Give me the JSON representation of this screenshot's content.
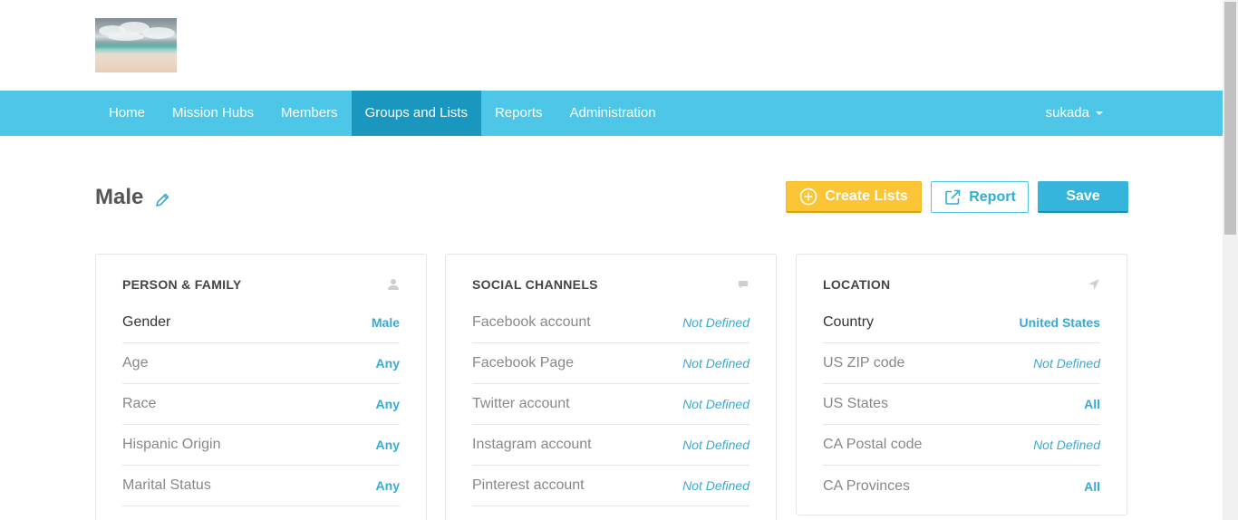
{
  "nav": {
    "items": [
      {
        "label": "Home",
        "active": false
      },
      {
        "label": "Mission Hubs",
        "active": false
      },
      {
        "label": "Members",
        "active": false
      },
      {
        "label": "Groups and Lists",
        "active": true
      },
      {
        "label": "Reports",
        "active": false
      },
      {
        "label": "Administration",
        "active": false
      }
    ],
    "user": "sukada"
  },
  "page": {
    "title": "Male"
  },
  "toolbar": {
    "create_label": "Create Lists",
    "report_label": "Report",
    "save_label": "Save"
  },
  "cards": {
    "person": {
      "title": "PERSON & FAMILY",
      "icon": "user-icon",
      "rows": [
        {
          "label": "Gender",
          "value": "Male"
        },
        {
          "label": "Age",
          "value": "Any"
        },
        {
          "label": "Race",
          "value": "Any"
        },
        {
          "label": "Hispanic Origin",
          "value": "Any"
        },
        {
          "label": "Marital Status",
          "value": "Any"
        }
      ]
    },
    "social": {
      "title": "SOCIAL CHANNELS",
      "icon": "chat-bubble-icon",
      "rows": [
        {
          "label": "Facebook account",
          "value": "Not Defined"
        },
        {
          "label": "Facebook Page",
          "value": "Not Defined"
        },
        {
          "label": "Twitter account",
          "value": "Not Defined"
        },
        {
          "label": "Instagram account",
          "value": "Not Defined"
        },
        {
          "label": "Pinterest account",
          "value": "Not Defined"
        }
      ]
    },
    "location": {
      "title": "LOCATION",
      "icon": "location-arrow-icon",
      "rows": [
        {
          "label": "Country",
          "value": "United States"
        },
        {
          "label": "US ZIP code",
          "value": "Not Defined"
        },
        {
          "label": "US States",
          "value": "All"
        },
        {
          "label": "CA Postal code",
          "value": "Not Defined"
        },
        {
          "label": "CA Provinces",
          "value": "All"
        }
      ]
    }
  },
  "colors": {
    "nav_bg": "#4dc6e8",
    "nav_active": "#1a97bf",
    "accent": "#3aa9d3",
    "create_button": "#fcc535"
  }
}
